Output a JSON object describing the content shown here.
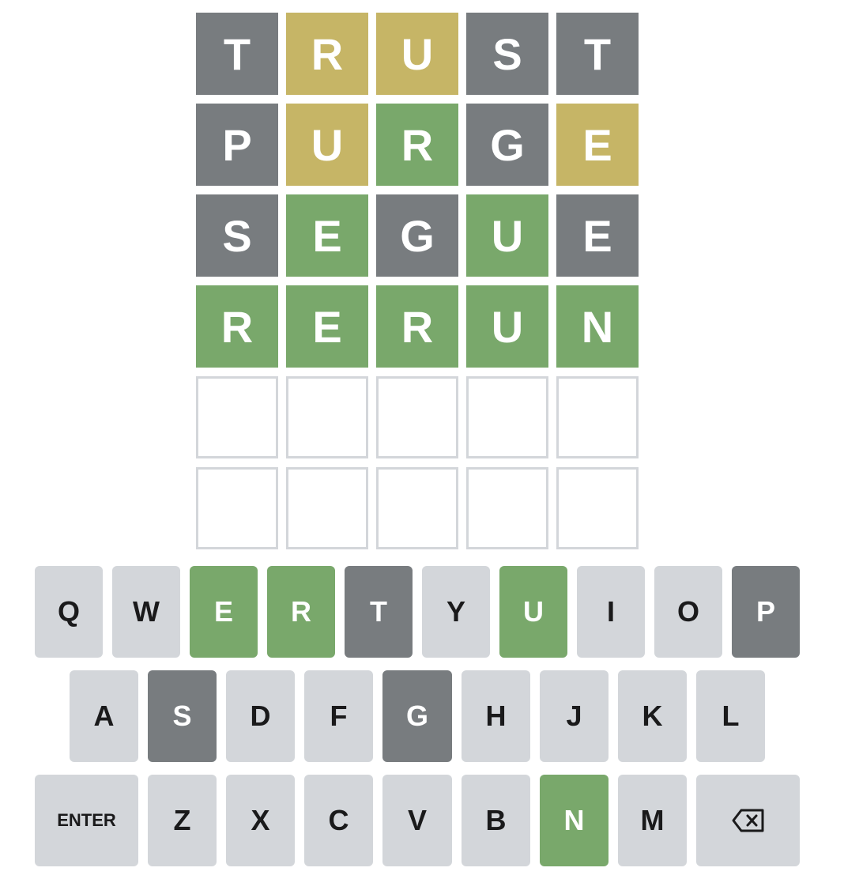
{
  "colors": {
    "correct": "#79a86b",
    "present": "#c6b566",
    "absent": "#787c7f",
    "key_default": "#d3d6da",
    "empty_border": "#d3d6da"
  },
  "board": [
    [
      {
        "letter": "T",
        "state": "absent"
      },
      {
        "letter": "R",
        "state": "present"
      },
      {
        "letter": "U",
        "state": "present"
      },
      {
        "letter": "S",
        "state": "absent"
      },
      {
        "letter": "T",
        "state": "absent"
      }
    ],
    [
      {
        "letter": "P",
        "state": "absent"
      },
      {
        "letter": "U",
        "state": "present"
      },
      {
        "letter": "R",
        "state": "correct"
      },
      {
        "letter": "G",
        "state": "absent"
      },
      {
        "letter": "E",
        "state": "present"
      }
    ],
    [
      {
        "letter": "S",
        "state": "absent"
      },
      {
        "letter": "E",
        "state": "correct"
      },
      {
        "letter": "G",
        "state": "absent"
      },
      {
        "letter": "U",
        "state": "correct"
      },
      {
        "letter": "E",
        "state": "absent"
      }
    ],
    [
      {
        "letter": "R",
        "state": "correct"
      },
      {
        "letter": "E",
        "state": "correct"
      },
      {
        "letter": "R",
        "state": "correct"
      },
      {
        "letter": "U",
        "state": "correct"
      },
      {
        "letter": "N",
        "state": "correct"
      }
    ],
    [
      {
        "letter": "",
        "state": "empty"
      },
      {
        "letter": "",
        "state": "empty"
      },
      {
        "letter": "",
        "state": "empty"
      },
      {
        "letter": "",
        "state": "empty"
      },
      {
        "letter": "",
        "state": "empty"
      }
    ],
    [
      {
        "letter": "",
        "state": "empty"
      },
      {
        "letter": "",
        "state": "empty"
      },
      {
        "letter": "",
        "state": "empty"
      },
      {
        "letter": "",
        "state": "empty"
      },
      {
        "letter": "",
        "state": "empty"
      }
    ]
  ],
  "keyboard": {
    "rows": [
      [
        {
          "label": "Q",
          "state": "default"
        },
        {
          "label": "W",
          "state": "default"
        },
        {
          "label": "E",
          "state": "correct"
        },
        {
          "label": "R",
          "state": "correct"
        },
        {
          "label": "T",
          "state": "absent"
        },
        {
          "label": "Y",
          "state": "default"
        },
        {
          "label": "U",
          "state": "correct"
        },
        {
          "label": "I",
          "state": "default"
        },
        {
          "label": "O",
          "state": "default"
        },
        {
          "label": "P",
          "state": "absent"
        }
      ],
      [
        {
          "label": "A",
          "state": "default"
        },
        {
          "label": "S",
          "state": "absent"
        },
        {
          "label": "D",
          "state": "default"
        },
        {
          "label": "F",
          "state": "default"
        },
        {
          "label": "G",
          "state": "absent"
        },
        {
          "label": "H",
          "state": "default"
        },
        {
          "label": "J",
          "state": "default"
        },
        {
          "label": "K",
          "state": "default"
        },
        {
          "label": "L",
          "state": "default"
        }
      ],
      [
        {
          "label": "ENTER",
          "state": "default",
          "kind": "enter"
        },
        {
          "label": "Z",
          "state": "default"
        },
        {
          "label": "X",
          "state": "default"
        },
        {
          "label": "C",
          "state": "default"
        },
        {
          "label": "V",
          "state": "default"
        },
        {
          "label": "B",
          "state": "default"
        },
        {
          "label": "N",
          "state": "correct"
        },
        {
          "label": "M",
          "state": "default"
        },
        {
          "label": "",
          "state": "default",
          "kind": "backspace",
          "icon": "backspace-icon"
        }
      ]
    ]
  }
}
